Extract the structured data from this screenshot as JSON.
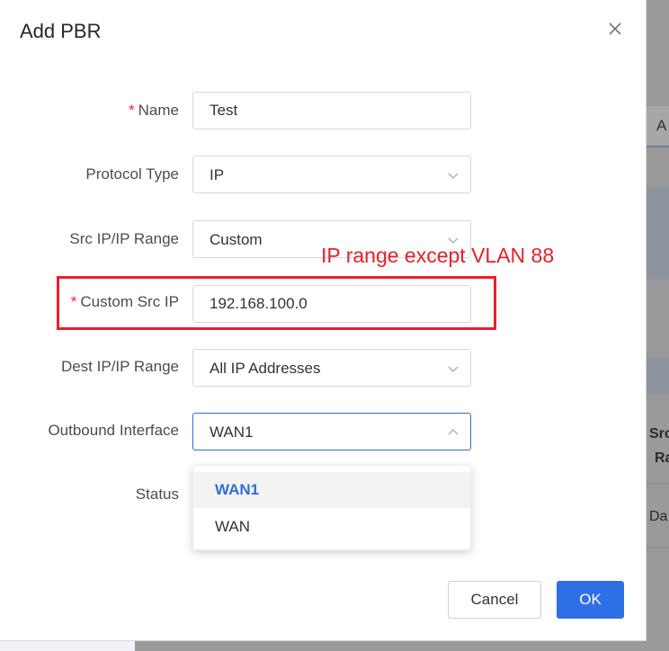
{
  "dialog": {
    "title": "Add PBR",
    "close_icon": "close-icon"
  },
  "form": {
    "name": {
      "label": "Name",
      "required": "*",
      "value": "Test"
    },
    "protocol_type": {
      "label": "Protocol Type",
      "value": "IP"
    },
    "src_ip_range": {
      "label": "Src IP/IP Range",
      "value": "Custom"
    },
    "custom_src_ip": {
      "label": "Custom Src IP",
      "required": "*",
      "value": "192.168.100.0"
    },
    "dest_ip_range": {
      "label": "Dest IP/IP Range",
      "value": "All IP Addresses"
    },
    "outbound_interface": {
      "label": "Outbound Interface",
      "value": "WAN1",
      "options": [
        "WAN1",
        "WAN"
      ]
    },
    "status": {
      "label": "Status"
    }
  },
  "annotation": {
    "text": "IP range except VLAN 88",
    "color": "#e8202a"
  },
  "buttons": {
    "cancel": "Cancel",
    "ok": "OK"
  },
  "background": {
    "tab_label": "A",
    "col_text_1": "Src",
    "col_text_2": "Ra",
    "row_text": "Da"
  },
  "colors": {
    "primary": "#2f6fe6",
    "required": "#f5222d"
  }
}
